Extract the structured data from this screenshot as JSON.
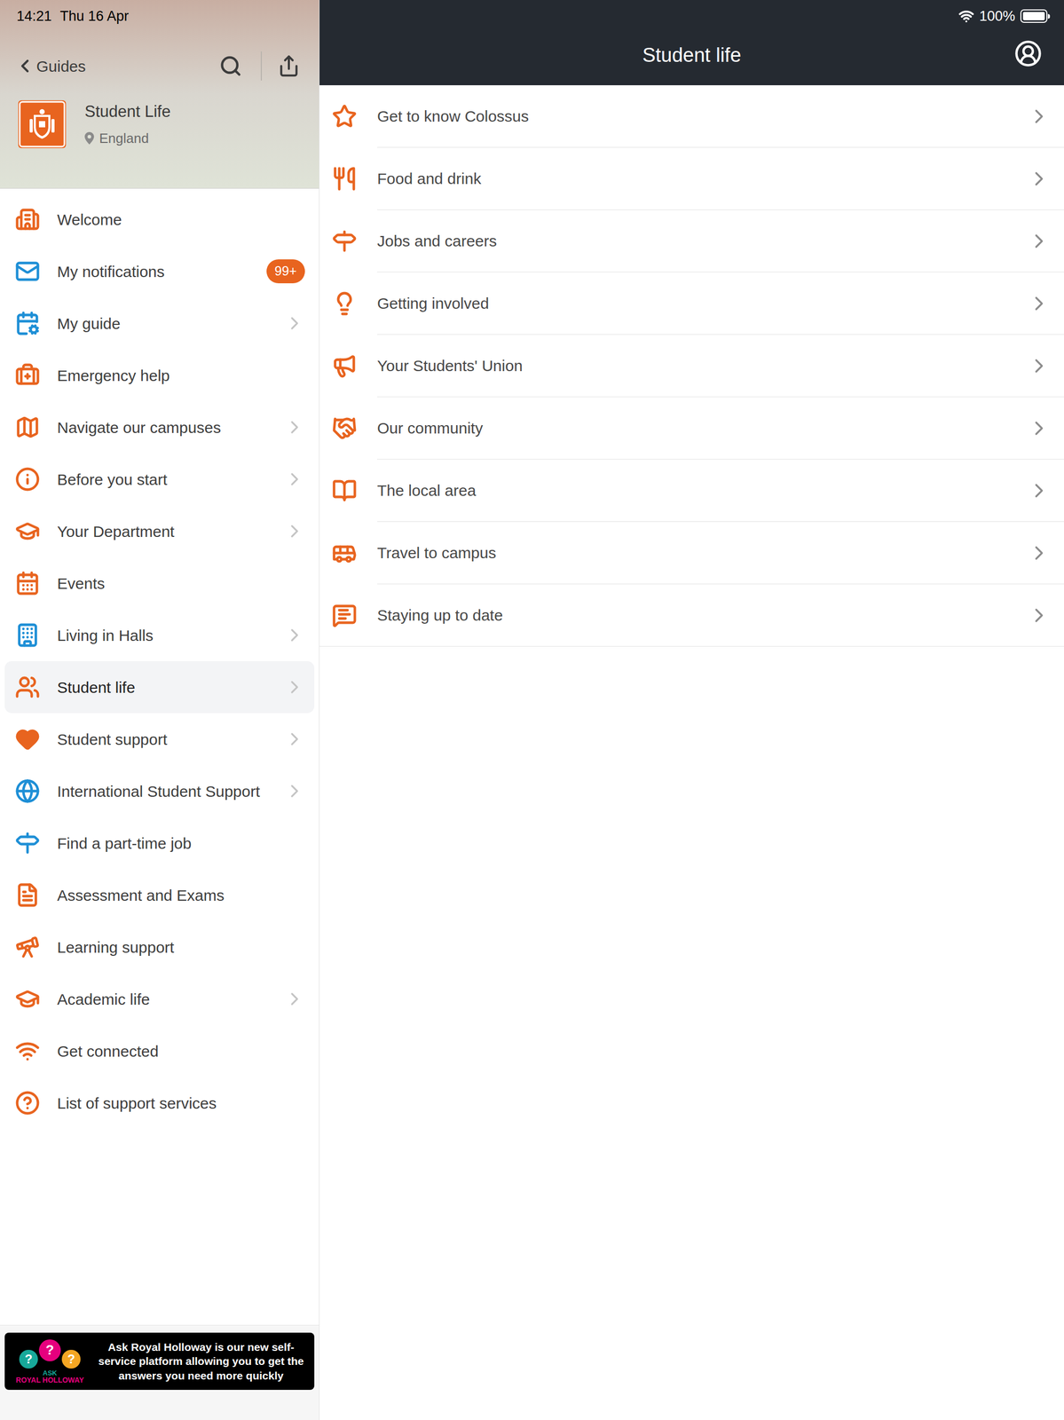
{
  "status_bar": {
    "time": "14:21",
    "date": "Thu 16 Apr",
    "battery": "100%",
    "battery_level": 1.0
  },
  "guide_header": {
    "back_label": "Guides",
    "title": "Student Life",
    "location": "England"
  },
  "sidebar": {
    "items": [
      {
        "label": "Welcome",
        "selected": false,
        "chevron": false,
        "badge": "",
        "color": "#e8641f"
      },
      {
        "label": "My notifications",
        "selected": false,
        "chevron": false,
        "badge": "99+",
        "color": "#1e8fd6"
      },
      {
        "label": "My guide",
        "selected": false,
        "chevron": true,
        "badge": "",
        "color": "#1e8fd6"
      },
      {
        "label": "Emergency help",
        "selected": false,
        "chevron": false,
        "badge": "",
        "color": "#e8641f"
      },
      {
        "label": "Navigate our campuses",
        "selected": false,
        "chevron": true,
        "badge": "",
        "color": "#e8641f"
      },
      {
        "label": "Before you start",
        "selected": false,
        "chevron": true,
        "badge": "",
        "color": "#e8641f"
      },
      {
        "label": "Your Department",
        "selected": false,
        "chevron": true,
        "badge": "",
        "color": "#e8641f"
      },
      {
        "label": "Events",
        "selected": false,
        "chevron": false,
        "badge": "",
        "color": "#e8641f"
      },
      {
        "label": "Living in Halls",
        "selected": false,
        "chevron": true,
        "badge": "",
        "color": "#1e8fd6"
      },
      {
        "label": "Student life",
        "selected": true,
        "chevron": true,
        "badge": "",
        "color": "#e8641f"
      },
      {
        "label": "Student support",
        "selected": false,
        "chevron": true,
        "badge": "",
        "color": "#e8641f"
      },
      {
        "label": "International Student Support",
        "selected": false,
        "chevron": true,
        "badge": "",
        "color": "#1e8fd6"
      },
      {
        "label": "Find a part-time job",
        "selected": false,
        "chevron": false,
        "badge": "",
        "color": "#1e8fd6"
      },
      {
        "label": "Assessment and Exams",
        "selected": false,
        "chevron": false,
        "badge": "",
        "color": "#e8641f"
      },
      {
        "label": "Learning support",
        "selected": false,
        "chevron": false,
        "badge": "",
        "color": "#e8641f"
      },
      {
        "label": "Academic life",
        "selected": false,
        "chevron": true,
        "badge": "",
        "color": "#e8641f"
      },
      {
        "label": "Get connected",
        "selected": false,
        "chevron": false,
        "badge": "",
        "color": "#e8641f"
      },
      {
        "label": "List of support services",
        "selected": false,
        "chevron": false,
        "badge": "",
        "color": "#e8641f"
      }
    ]
  },
  "banner": {
    "logo_glyph": "?",
    "logo_top": "ASK",
    "logo_bottom": "ROYAL HOLLOWAY",
    "text": "Ask Royal Holloway is our new self-service platform allowing you to get the answers you need more quickly"
  },
  "content": {
    "title": "Student life",
    "items": [
      {
        "label": "Get to know Colossus"
      },
      {
        "label": "Food and drink"
      },
      {
        "label": "Jobs and careers"
      },
      {
        "label": "Getting involved"
      },
      {
        "label": "Your Students' Union"
      },
      {
        "label": "Our community"
      },
      {
        "label": "The local area"
      },
      {
        "label": "Travel to campus"
      },
      {
        "label": "Staying up to date"
      }
    ]
  }
}
